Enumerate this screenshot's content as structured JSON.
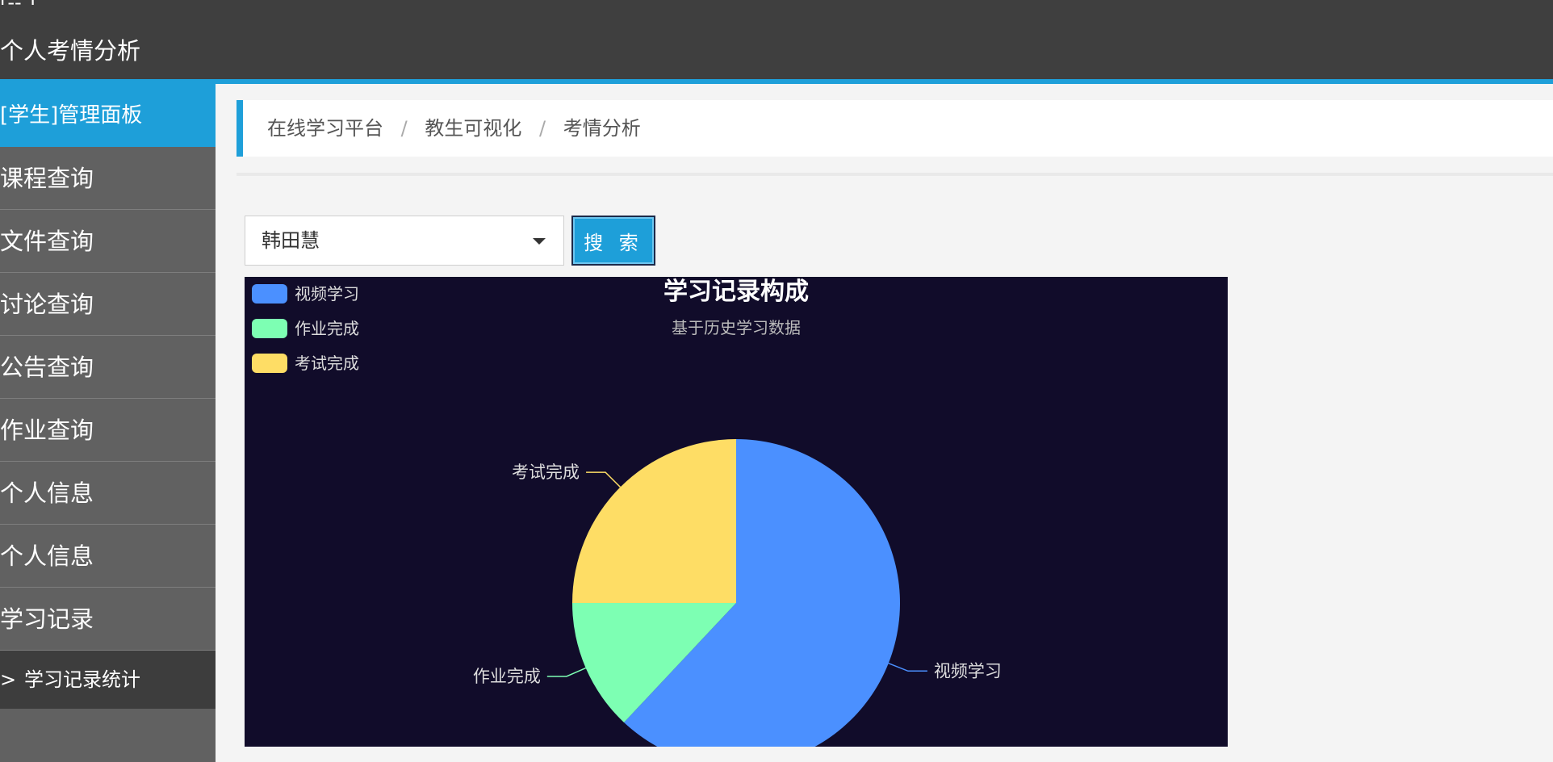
{
  "header": {
    "top_stub": "[-- ]",
    "title": "个人考情分析"
  },
  "sidebar": {
    "panel_title": "[学生]管理面板",
    "items": [
      {
        "label": "课程查询"
      },
      {
        "label": "文件查询"
      },
      {
        "label": "讨论查询"
      },
      {
        "label": "公告查询"
      },
      {
        "label": "作业查询"
      },
      {
        "label": "个人信息"
      },
      {
        "label": "个人信息"
      },
      {
        "label": "学习记录"
      }
    ],
    "sub_item": {
      "arrow": ">",
      "label": "学习记录统计"
    }
  },
  "breadcrumb": [
    "在线学习平台",
    "教生可视化",
    "考情分析"
  ],
  "breadcrumb_sep": "/",
  "filter": {
    "selected": "韩田慧",
    "search_label": "搜 索"
  },
  "colors": {
    "accent": "#1e9fd9",
    "chart_bg": "#110c2a"
  },
  "chart_data": {
    "type": "pie",
    "title": "学习记录构成",
    "subtitle": "基于历史学习数据",
    "legend_position": "top-left",
    "series": [
      {
        "name": "视频学习",
        "value": 62,
        "color": "#4b90ff"
      },
      {
        "name": "作业完成",
        "value": 13,
        "color": "#7dffb3"
      },
      {
        "name": "考试完成",
        "value": 25,
        "color": "#fedd65"
      }
    ]
  }
}
